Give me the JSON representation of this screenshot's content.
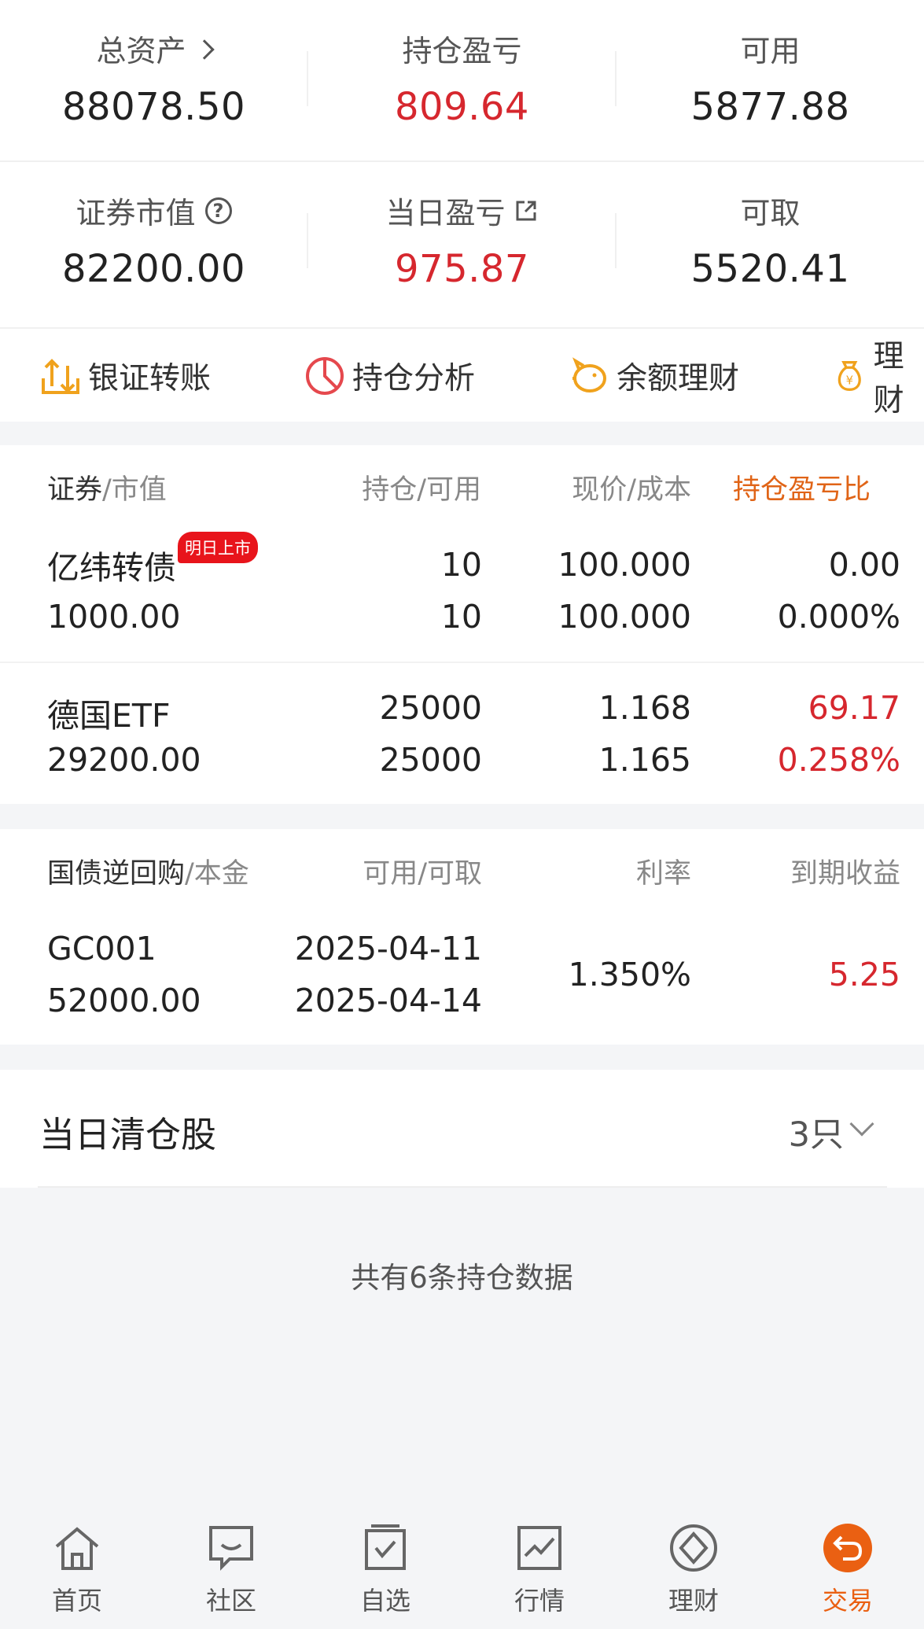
{
  "summary": {
    "total_assets_label": "总资产",
    "total_assets": "88078.50",
    "position_pl_label": "持仓盈亏",
    "position_pl": "809.64",
    "available_label": "可用",
    "available": "5877.88",
    "market_value_label": "证券市值",
    "market_value": "82200.00",
    "daily_pl_label": "当日盈亏",
    "daily_pl": "975.87",
    "withdrawable_label": "可取",
    "withdrawable": "5520.41"
  },
  "quick_actions": [
    {
      "label": "银证转账",
      "icon": "transfer-icon"
    },
    {
      "label": "持仓分析",
      "icon": "pie-chart-icon"
    },
    {
      "label": "余额理财",
      "icon": "piggy-bank-icon"
    },
    {
      "label": "理财",
      "icon": "money-bag-icon"
    }
  ],
  "holdings": {
    "headers": {
      "security": "证券",
      "market_value": "/市值",
      "position": "持仓/可用",
      "price": "现价/成本",
      "pl_ratio": "持仓盈亏比"
    },
    "rows": [
      {
        "name": "亿纬转债",
        "badge": "明日上市",
        "value": "1000.00",
        "position": "10",
        "available": "10",
        "price": "100.000",
        "cost": "100.000",
        "pl": "0.00",
        "pl_pct": "0.000%"
      },
      {
        "name": "德国ETF",
        "value": "29200.00",
        "position": "25000",
        "available": "25000",
        "price": "1.168",
        "cost": "1.165",
        "pl": "69.17",
        "pl_pct": "0.258%"
      }
    ]
  },
  "repo": {
    "headers": {
      "name": "国债逆回购",
      "principal": "/本金",
      "dates": "可用/可取",
      "rate": "利率",
      "yield": "到期收益"
    },
    "row": {
      "code": "GC001",
      "principal": "52000.00",
      "available_date": "2025-04-11",
      "withdraw_date": "2025-04-14",
      "rate": "1.350%",
      "yield": "5.25"
    }
  },
  "clearance": {
    "title": "当日清仓股",
    "count": "3只"
  },
  "total_note": "共有6条持仓数据",
  "nav": [
    {
      "label": "首页",
      "icon": "home-icon"
    },
    {
      "label": "社区",
      "icon": "chat-icon"
    },
    {
      "label": "自选",
      "icon": "watchlist-icon"
    },
    {
      "label": "行情",
      "icon": "market-chart-icon"
    },
    {
      "label": "理财",
      "icon": "diamond-icon"
    },
    {
      "label": "交易",
      "icon": "trade-return-icon"
    }
  ],
  "colors": {
    "accent": "#ea6012",
    "up_red": "#d6272e",
    "badge_red": "#e8141b"
  }
}
